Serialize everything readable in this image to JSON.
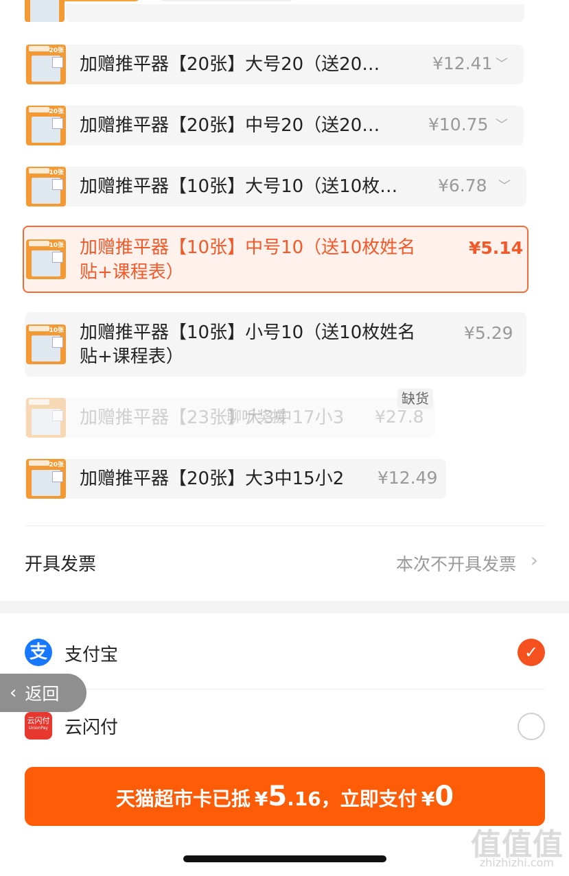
{
  "skus": [
    {
      "name": "加赠推平器【20张】大号20（送20…",
      "price": "¥12.41",
      "thumb_count": "20张"
    },
    {
      "name": "加赠推平器【20张】中号20（送20…",
      "price": "¥10.75",
      "thumb_count": "20张"
    },
    {
      "name": "加赠推平器【10张】大号10（送10枚…",
      "price": "¥6.78",
      "thumb_count": "10张"
    },
    {
      "name_line1": "加赠推平器【10张】中号10（送10枚姓名",
      "name_line2": "贴+课程表）",
      "price": "¥5.14",
      "thumb_count": "10张",
      "selected": true
    },
    {
      "name_line1": "加赠推平器【10张】小号10（送10枚姓名",
      "name_line2": "贴+课程表）",
      "price": "¥5.29",
      "thumb_count": "10张"
    },
    {
      "name": "加赠推平器【23张】大3中17小3",
      "price": "¥27.8",
      "badge": "缺货",
      "overlay": "聊听奖援"
    },
    {
      "name": "加赠推平器【20张】大3中15小2",
      "price": "¥12.49",
      "thumb_count": "20张"
    }
  ],
  "invoice": {
    "label": "开具发票",
    "value": "本次不开具发票"
  },
  "payment": {
    "alipay": {
      "label": "支付宝",
      "icon_text": "支",
      "checked": true
    },
    "unionpay": {
      "label": "云闪付",
      "icon_text": "云闪付",
      "icon_sub": "UnionPay",
      "checked": false
    }
  },
  "back": {
    "label": "返回"
  },
  "pay_button": {
    "prefix": "天猫超市卡已抵",
    "currency": "¥",
    "deduct_int": "5",
    "deduct_dec": ".16",
    "middle": "，立即支付",
    "pay_amount": "0"
  },
  "watermark": {
    "brand": "值值值",
    "site": "zhizhizhi.com"
  },
  "colors": {
    "accent": "#fe5c07",
    "selected_border": "#f26b3a",
    "alipay_blue": "#1677ff",
    "unionpay_red": "#e8372f"
  }
}
